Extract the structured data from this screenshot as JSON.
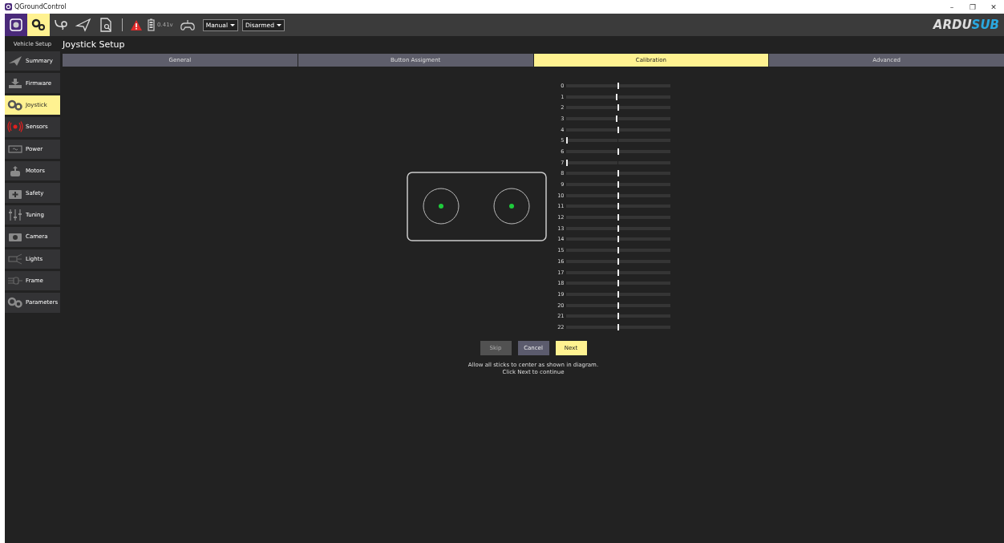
{
  "window": {
    "title": "QGroundControl",
    "controls": [
      "–",
      "❐",
      "✕"
    ]
  },
  "toolbar": {
    "views": [
      {
        "kind": "setup",
        "selected": false
      },
      {
        "kind": "vehicle",
        "selected": true
      },
      {
        "kind": "plan",
        "selected": false
      },
      {
        "kind": "fly",
        "selected": false
      },
      {
        "kind": "analyze",
        "selected": false
      }
    ],
    "battery": "0.41v",
    "mode": "Manual",
    "arm_state": "Disarmed",
    "logo": [
      "ARDU",
      "SUB"
    ]
  },
  "sidebar": {
    "header": "Vehicle Setup",
    "items": [
      {
        "label": "Summary",
        "selected": false
      },
      {
        "label": "Firmware",
        "selected": false
      },
      {
        "label": "Joystick",
        "selected": true
      },
      {
        "label": "Sensors",
        "selected": false
      },
      {
        "label": "Power",
        "selected": false
      },
      {
        "label": "Motors",
        "selected": false
      },
      {
        "label": "Safety",
        "selected": false
      },
      {
        "label": "Tuning",
        "selected": false
      },
      {
        "label": "Camera",
        "selected": false
      },
      {
        "label": "Lights",
        "selected": false
      },
      {
        "label": "Frame",
        "selected": false
      },
      {
        "label": "Parameters",
        "selected": false
      }
    ]
  },
  "page": {
    "title": "Joystick Setup",
    "tabs": [
      {
        "label": "General",
        "selected": false
      },
      {
        "label": "Button Assigment",
        "selected": false
      },
      {
        "label": "Calibration",
        "selected": true
      },
      {
        "label": "Advanced",
        "selected": false
      }
    ],
    "channels": [
      {
        "label": "0",
        "level": 0.5
      },
      {
        "label": "1",
        "level": 0.49
      },
      {
        "label": "2",
        "level": 0.5
      },
      {
        "label": "3",
        "level": 0.49
      },
      {
        "label": "4",
        "level": 0.5
      },
      {
        "label": "5",
        "level": 0
      },
      {
        "label": "6",
        "level": 0.5
      },
      {
        "label": "7",
        "level": 0
      },
      {
        "label": "8",
        "level": 0.5
      },
      {
        "label": "9",
        "level": 0.5
      },
      {
        "label": "10",
        "level": 0.5
      },
      {
        "label": "11",
        "level": 0.5
      },
      {
        "label": "12",
        "level": 0.5
      },
      {
        "label": "13",
        "level": 0.5
      },
      {
        "label": "14",
        "level": 0.5
      },
      {
        "label": "15",
        "level": 0.5
      },
      {
        "label": "16",
        "level": 0.5
      },
      {
        "label": "17",
        "level": 0.5
      },
      {
        "label": "18",
        "level": 0.5
      },
      {
        "label": "19",
        "level": 0.5
      },
      {
        "label": "20",
        "level": 0.5
      },
      {
        "label": "21",
        "level": 0.5
      },
      {
        "label": "22",
        "level": 0.5
      }
    ],
    "buttons": [
      {
        "label": "Skip",
        "kind": "skip",
        "disabled": true
      },
      {
        "label": "Cancel",
        "kind": "cancel",
        "disabled": false
      },
      {
        "label": "Next",
        "kind": "next",
        "disabled": false
      }
    ],
    "instructions": [
      "Allow all sticks to center as shown in diagram.",
      "Click Next to continue"
    ]
  }
}
